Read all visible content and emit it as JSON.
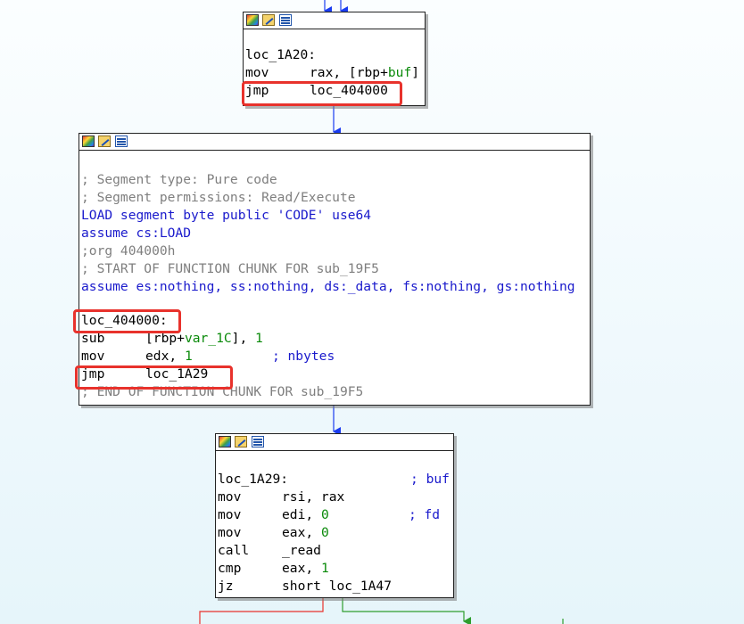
{
  "colors": {
    "edge_blue": "#1a3cf0",
    "edge_red": "#e8322c",
    "edge_green": "#2e9e2e",
    "highlight": "#e8322c"
  },
  "toolbar_icons": [
    "graph-icon",
    "edit-icon",
    "list-icon"
  ],
  "node1": {
    "label": "loc_1A20:",
    "l1_op": "mov",
    "l1_args_a": "rax, [rbp+",
    "l1_args_b": "buf",
    "l1_args_c": "]",
    "l2_op": "jmp",
    "l2_args": "loc_404000"
  },
  "node2": {
    "c1": "; Segment type: Pure code",
    "c2": "; Segment permissions: Read/Execute",
    "d1": "LOAD segment byte public 'CODE' use64",
    "d2": "assume cs:LOAD",
    "c3": ";org 404000h",
    "c4": "; START OF FUNCTION CHUNK FOR sub_19F5",
    "d3": "assume es:nothing, ss:nothing, ds:_data, fs:nothing, gs:nothing",
    "label": "loc_404000:",
    "i1_op": "sub",
    "i1_a": "[rbp+",
    "i1_b": "var_1C",
    "i1_c": "], ",
    "i1_n": "1",
    "i2_op": "mov",
    "i2_a": "edx, ",
    "i2_n": "1",
    "i2_cmt": "; nbytes",
    "i3_op": "jmp",
    "i3_a": "loc_1A29",
    "c5": "; END OF FUNCTION CHUNK FOR sub_19F5"
  },
  "node3": {
    "label": "loc_1A29:",
    "label_cmt": "; buf",
    "i1_op": "mov",
    "i1_a": "rsi, rax",
    "i2_op": "mov",
    "i2_a": "edi, ",
    "i2_n": "0",
    "i2_cmt": "; fd",
    "i3_op": "mov",
    "i3_a": "eax, ",
    "i3_n": "0",
    "i4_op": "call",
    "i4_a": "_read",
    "i5_op": "cmp",
    "i5_a": "eax, ",
    "i5_n": "1",
    "i6_op": "jz",
    "i6_a": "short loc_1A47"
  }
}
